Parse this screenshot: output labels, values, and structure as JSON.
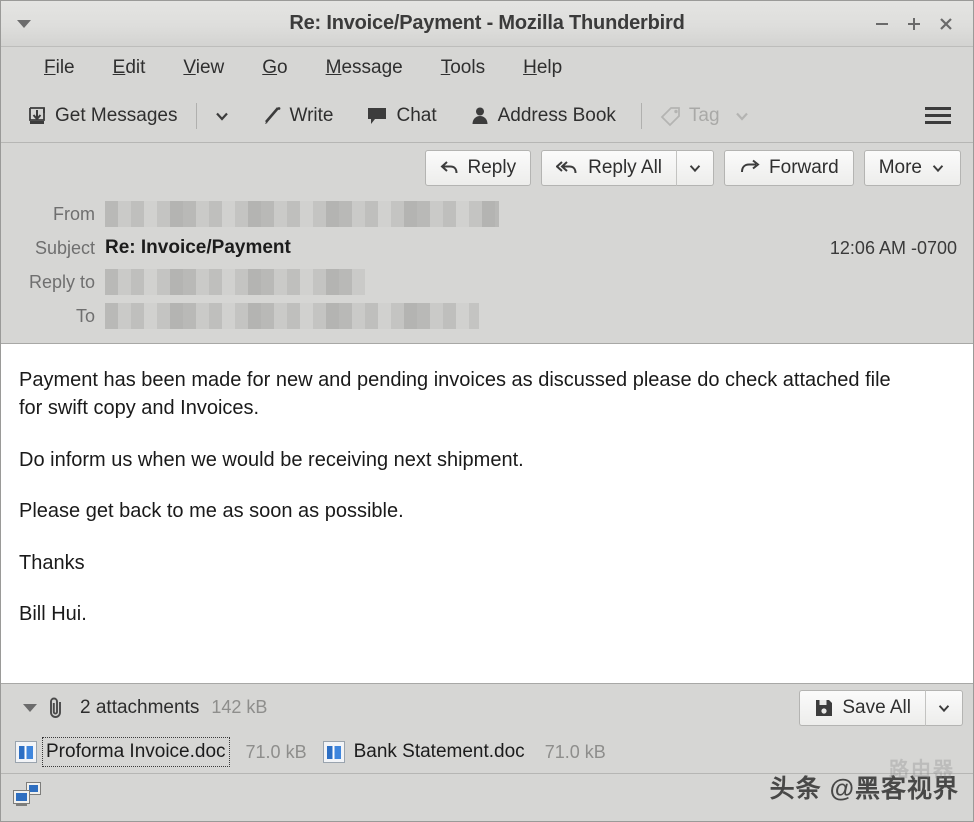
{
  "window": {
    "title": "Re: Invoice/Payment - Mozilla Thunderbird",
    "menu_arrow_icon": "triangle-down-icon",
    "minimize_label": "−",
    "maximize_label": "+",
    "close_label": "×"
  },
  "menubar": {
    "items": [
      {
        "acc": "F",
        "rest": "ile"
      },
      {
        "acc": "E",
        "rest": "dit"
      },
      {
        "acc": "V",
        "rest": "iew"
      },
      {
        "acc": "G",
        "rest": "o"
      },
      {
        "acc": "M",
        "rest": "essage"
      },
      {
        "acc": "T",
        "rest": "ools"
      },
      {
        "acc": "H",
        "rest": "elp"
      }
    ]
  },
  "toolbar": {
    "get_messages_label": "Get Messages",
    "get_messages_icon": "download-inbox-icon",
    "get_messages_dropdown_icon": "chevron-down-icon",
    "write_label": "Write",
    "write_icon": "pencil-icon",
    "chat_label": "Chat",
    "chat_icon": "speech-bubble-icon",
    "address_book_label": "Address Book",
    "address_book_icon": "person-icon",
    "tag_label": "Tag",
    "tag_icon": "tag-icon",
    "tag_dropdown_icon": "chevron-down-icon",
    "tag_disabled": true,
    "app_menu_icon": "hamburger-menu-icon"
  },
  "replybar": {
    "reply_label": "Reply",
    "reply_icon": "reply-arrow-icon",
    "reply_all_label": "Reply All",
    "reply_all_icon": "reply-all-arrow-icon",
    "reply_all_dropdown_icon": "chevron-down-icon",
    "forward_label": "Forward",
    "forward_icon": "forward-arrow-icon",
    "more_label": "More",
    "more_dropdown_icon": "chevron-down-icon"
  },
  "message_headers": {
    "from_label": "From",
    "from_value": "",
    "from_redacted": true,
    "subject_label": "Subject",
    "subject_value": "Re: Invoice/Payment",
    "timestamp": "12:06 AM -0700",
    "reply_to_label": "Reply to",
    "reply_to_value": "",
    "reply_to_redacted": true,
    "to_label": "To",
    "to_value": "",
    "to_redacted": true
  },
  "body": {
    "paragraphs": [
      "Payment has been made for new and pending invoices as discussed please do check attached file for swift copy and Invoices.",
      "Do inform us when we would be receiving next shipment.",
      "Please get back to me as soon as possible.",
      "Thanks",
      "Bill Hui."
    ]
  },
  "attachments": {
    "toggle_icon": "triangle-down-icon",
    "paperclip_icon": "paperclip-icon",
    "count_label": "2 attachments",
    "total_size": "142 kB",
    "save_all_label": "Save All",
    "save_all_icon": "save-disk-icon",
    "save_all_dropdown_icon": "chevron-down-icon",
    "items": [
      {
        "name": "Proforma Invoice.doc",
        "size": "71.0 kB",
        "icon": "word-doc-icon",
        "selected": true
      },
      {
        "name": "Bank Statement.doc",
        "size": "71.0 kB",
        "icon": "word-doc-icon",
        "selected": false
      }
    ]
  },
  "statusbar": {
    "network_icon": "network-computers-icon"
  },
  "watermark": {
    "text": "头条 @黑客视界",
    "ghost_text": "路由器"
  },
  "colors": {
    "chrome": "#d6d6d4",
    "body_bg": "#ffffff",
    "text": "#1a1a1a",
    "muted": "#8e8e8c",
    "accent_blue": "#2d6fc4"
  }
}
